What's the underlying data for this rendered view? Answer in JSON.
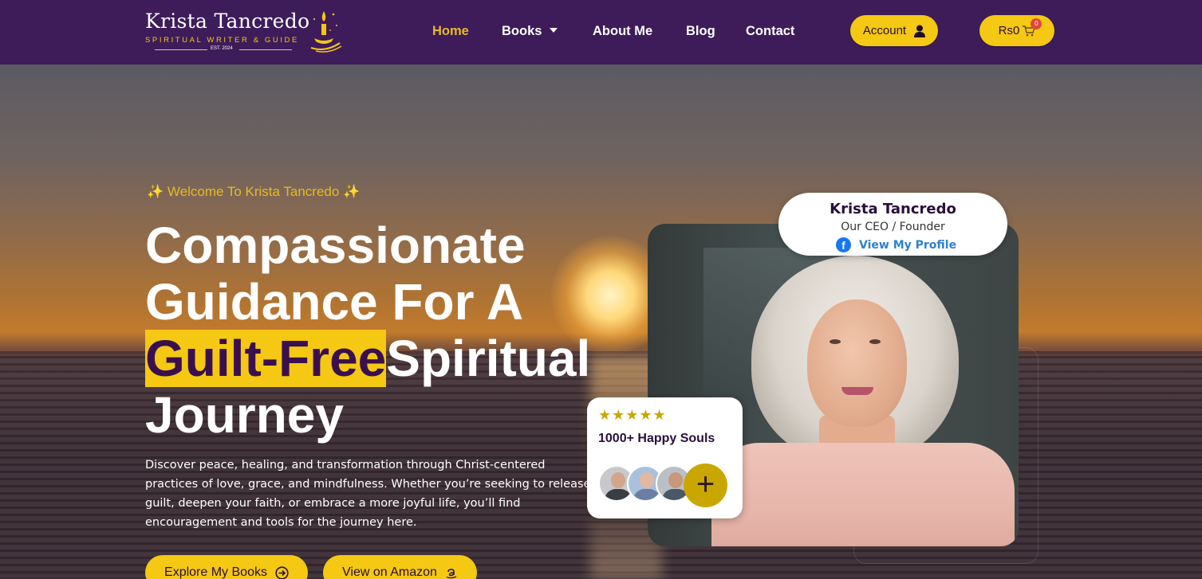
{
  "brand": {
    "name": "Krista Tancredo",
    "tagline": "SPIRITUAL WRITER & GUIDE",
    "est": "EST. 2024"
  },
  "nav": {
    "items": [
      {
        "label": "Home",
        "active": true
      },
      {
        "label": "Books",
        "has_dropdown": true
      },
      {
        "label": "About Me"
      },
      {
        "label": "Blog"
      },
      {
        "label": "Contact"
      }
    ]
  },
  "header_actions": {
    "account_label": "Account",
    "cart_label": "Rs0",
    "cart_count": "0"
  },
  "hero": {
    "welcome": "✨ Welcome To Krista Tancredo ✨",
    "headline_line1": "Compassionate",
    "headline_line2": "Guidance For A",
    "headline_highlight": "Guilt-Free",
    "headline_line3_rest": "Spiritual",
    "headline_line4": "Journey",
    "description": "Discover peace, healing, and transformation through Christ-centered practices of love, grace, and mindfulness. Whether you’re seeking to release guilt, deepen your faith, or embrace a more joyful life, you’ll find encouragement and tools for the journey here.",
    "cta_primary": "Explore My Books",
    "cta_secondary": "View on Amazon"
  },
  "profile_card": {
    "name": "Krista Tancredo",
    "role": "Our CEO / Founder",
    "link_label": "View My Profile"
  },
  "souls_card": {
    "stars": "★★★★★",
    "rating": 5,
    "label": "1000+ Happy Souls",
    "plus_symbol": "+"
  },
  "colors": {
    "header_bg": "#3e1c5a",
    "accent_yellow": "#f4c813",
    "highlight_text": "#3a0f4e",
    "nav_active": "#e8b923"
  }
}
